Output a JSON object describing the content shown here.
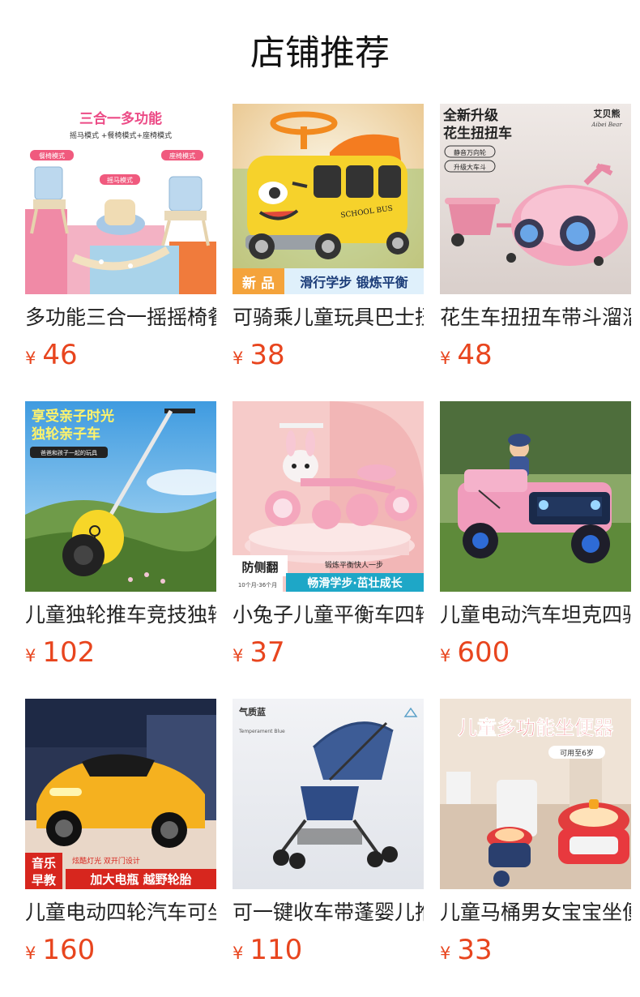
{
  "section": {
    "title": "店铺推荐"
  },
  "currency": "¥",
  "products": [
    {
      "name": "多功能三合一摇摇椅餐椅",
      "price": "46",
      "icon": "rocking-chair-image",
      "image_text": [
        "三合一多功能",
        "摇马模式 +餐椅模式+座椅模式",
        "餐椅模式",
        "摇马模式",
        "座椅模式"
      ]
    },
    {
      "name": "可骑乘儿童玩具巴士扭扭车",
      "price": "38",
      "icon": "school-bus-ride-on-image",
      "image_text": [
        "SCHOOL BUS",
        "新 品",
        "滑行学步 锻炼平衡"
      ]
    },
    {
      "name": "花生车扭扭车带斗溜溜车",
      "price": "48",
      "icon": "peanut-swing-car-image",
      "image_text": [
        "全新升级",
        "花生扭扭车",
        "静音万向轮",
        "升级大车斗",
        "艾贝熊",
        "Aibei Bear"
      ]
    },
    {
      "name": "儿童独轮推车竞技独轮车",
      "price": "102",
      "icon": "unicycle-push-cart-image",
      "image_text": [
        "享受亲子时光",
        "独轮亲子车",
        "爸爸和孩子一起的玩具"
      ]
    },
    {
      "name": "小兔子儿童平衡车四轮",
      "price": "37",
      "icon": "rabbit-balance-bike-image",
      "image_text": [
        "防侧翻",
        "锻炼平衡快人一步",
        "畅滑学步·茁壮成长",
        "10个月-36个月"
      ]
    },
    {
      "name": "儿童电动汽车坦克四驱",
      "price": "600",
      "icon": "electric-jeep-image",
      "image_text": []
    },
    {
      "name": "儿童电动四轮汽车可坐人",
      "price": "160",
      "icon": "electric-sports-car-image",
      "image_text": [
        "音乐",
        "早教",
        "炫酷灯光 双开门设计",
        "加大电瓶 越野轮胎"
      ]
    },
    {
      "name": "可一键收车带蓬婴儿推车",
      "price": "110",
      "icon": "baby-stroller-image",
      "image_text": [
        "气质蓝",
        "Temperament Blue"
      ]
    },
    {
      "name": "儿童马桶男女宝宝坐便器",
      "price": "33",
      "icon": "potty-seat-image",
      "image_text": [
        "儿童多功能坐便器",
        "可用至6岁"
      ]
    }
  ]
}
